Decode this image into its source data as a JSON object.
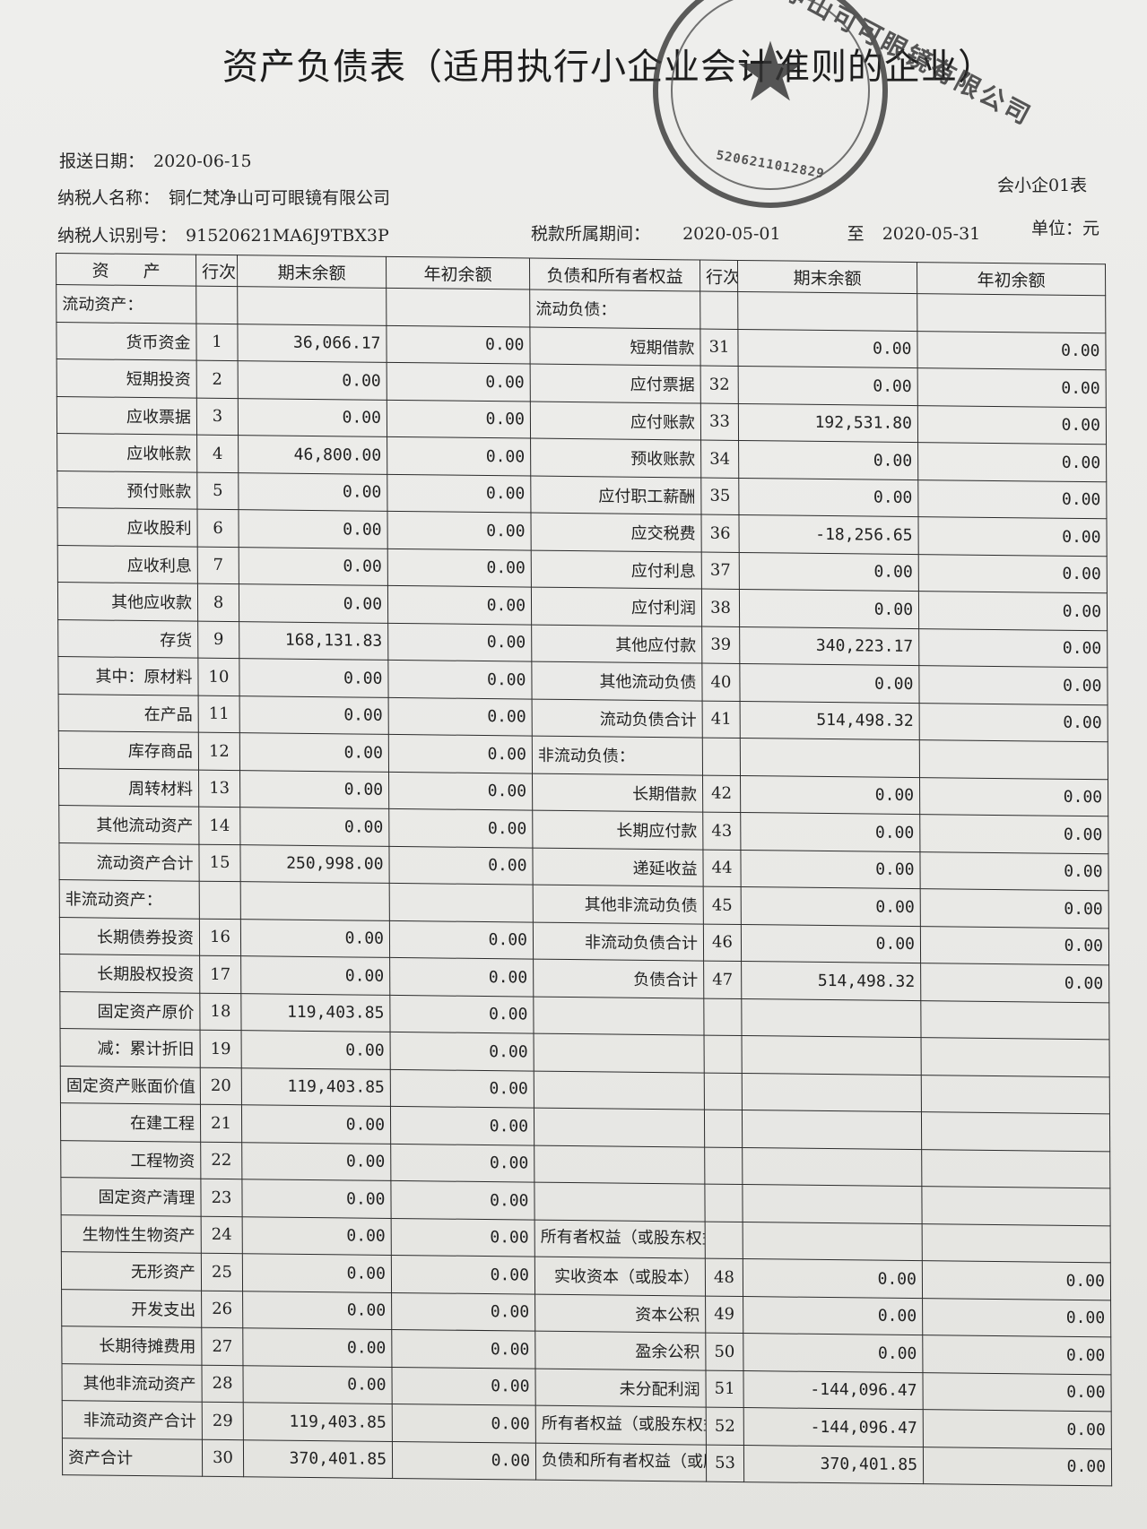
{
  "title": "资产负债表（适用执行小企业会计准则的企业）",
  "meta": {
    "report_date_label": "报送日期：",
    "report_date": "2020-06-15",
    "taxpayer_name_label": "纳税人名称：",
    "taxpayer_name": "铜仁梵净山可可眼镜有限公司",
    "taxpayer_id_label": "纳税人识别号：",
    "taxpayer_id": "91520621MA6J9TBX3P",
    "period_label": "税款所属期间：",
    "period_start": "2020-05-01",
    "period_to": "至",
    "period_end": "2020-05-31",
    "form_code": "会小企01表",
    "unit": "单位：元"
  },
  "stamp": {
    "text": "铜仁梵净山可可眼镜有限公司",
    "code": "5206211012829"
  },
  "headers": {
    "assets": "资　　产",
    "row": "行次",
    "end_balance": "期末余额",
    "begin_balance": "年初余额",
    "liabilities": "负债和所有者权益",
    "row2": "行次",
    "end_balance2": "期末余额",
    "begin_balance2": "年初余额"
  },
  "sections": {
    "current_assets": "流动资产：",
    "current_liabilities": "流动负债：",
    "noncurrent_assets": "非流动资产：",
    "noncurrent_liabilities": "非流动负债：",
    "equity": "所有者权益（或股东权益）："
  },
  "assets": [
    {
      "name": "货币资金",
      "row": "1",
      "end": "36,066.17",
      "begin": "0.00"
    },
    {
      "name": "短期投资",
      "row": "2",
      "end": "0.00",
      "begin": "0.00"
    },
    {
      "name": "应收票据",
      "row": "3",
      "end": "0.00",
      "begin": "0.00"
    },
    {
      "name": "应收帐款",
      "row": "4",
      "end": "46,800.00",
      "begin": "0.00"
    },
    {
      "name": "预付账款",
      "row": "5",
      "end": "0.00",
      "begin": "0.00"
    },
    {
      "name": "应收股利",
      "row": "6",
      "end": "0.00",
      "begin": "0.00"
    },
    {
      "name": "应收利息",
      "row": "7",
      "end": "0.00",
      "begin": "0.00"
    },
    {
      "name": "其他应收款",
      "row": "8",
      "end": "0.00",
      "begin": "0.00"
    },
    {
      "name": "存货",
      "row": "9",
      "end": "168,131.83",
      "begin": "0.00"
    },
    {
      "name": "其中：原材料",
      "row": "10",
      "end": "0.00",
      "begin": "0.00"
    },
    {
      "name": "在产品",
      "row": "11",
      "end": "0.00",
      "begin": "0.00"
    },
    {
      "name": "库存商品",
      "row": "12",
      "end": "0.00",
      "begin": "0.00"
    },
    {
      "name": "周转材料",
      "row": "13",
      "end": "0.00",
      "begin": "0.00"
    },
    {
      "name": "其他流动资产",
      "row": "14",
      "end": "0.00",
      "begin": "0.00"
    },
    {
      "name": "流动资产合计",
      "row": "15",
      "end": "250,998.00",
      "begin": "0.00"
    },
    {
      "name": "长期债券投资",
      "row": "16",
      "end": "0.00",
      "begin": "0.00"
    },
    {
      "name": "长期股权投资",
      "row": "17",
      "end": "0.00",
      "begin": "0.00"
    },
    {
      "name": "固定资产原价",
      "row": "18",
      "end": "119,403.85",
      "begin": "0.00"
    },
    {
      "name": "减：累计折旧",
      "row": "19",
      "end": "0.00",
      "begin": "0.00"
    },
    {
      "name": "固定资产账面价值",
      "row": "20",
      "end": "119,403.85",
      "begin": "0.00"
    },
    {
      "name": "在建工程",
      "row": "21",
      "end": "0.00",
      "begin": "0.00"
    },
    {
      "name": "工程物资",
      "row": "22",
      "end": "0.00",
      "begin": "0.00"
    },
    {
      "name": "固定资产清理",
      "row": "23",
      "end": "0.00",
      "begin": "0.00"
    },
    {
      "name": "生物性生物资产",
      "row": "24",
      "end": "0.00",
      "begin": "0.00"
    },
    {
      "name": "无形资产",
      "row": "25",
      "end": "0.00",
      "begin": "0.00"
    },
    {
      "name": "开发支出",
      "row": "26",
      "end": "0.00",
      "begin": "0.00"
    },
    {
      "name": "长期待摊费用",
      "row": "27",
      "end": "0.00",
      "begin": "0.00"
    },
    {
      "name": "其他非流动资产",
      "row": "28",
      "end": "0.00",
      "begin": "0.00"
    },
    {
      "name": "非流动资产合计",
      "row": "29",
      "end": "119,403.85",
      "begin": "0.00"
    },
    {
      "name": "资产合计",
      "row": "30",
      "end": "370,401.85",
      "begin": "0.00"
    }
  ],
  "liabilities": [
    {
      "name": "短期借款",
      "row": "31",
      "end": "0.00",
      "begin": "0.00"
    },
    {
      "name": "应付票据",
      "row": "32",
      "end": "0.00",
      "begin": "0.00"
    },
    {
      "name": "应付账款",
      "row": "33",
      "end": "192,531.80",
      "begin": "0.00"
    },
    {
      "name": "预收账款",
      "row": "34",
      "end": "0.00",
      "begin": "0.00"
    },
    {
      "name": "应付职工薪酬",
      "row": "35",
      "end": "0.00",
      "begin": "0.00"
    },
    {
      "name": "应交税费",
      "row": "36",
      "end": "-18,256.65",
      "begin": "0.00"
    },
    {
      "name": "应付利息",
      "row": "37",
      "end": "0.00",
      "begin": "0.00"
    },
    {
      "name": "应付利润",
      "row": "38",
      "end": "0.00",
      "begin": "0.00"
    },
    {
      "name": "其他应付款",
      "row": "39",
      "end": "340,223.17",
      "begin": "0.00"
    },
    {
      "name": "其他流动负债",
      "row": "40",
      "end": "0.00",
      "begin": "0.00"
    },
    {
      "name": "流动负债合计",
      "row": "41",
      "end": "514,498.32",
      "begin": "0.00"
    },
    {
      "name": "长期借款",
      "row": "42",
      "end": "0.00",
      "begin": "0.00"
    },
    {
      "name": "长期应付款",
      "row": "43",
      "end": "0.00",
      "begin": "0.00"
    },
    {
      "name": "递延收益",
      "row": "44",
      "end": "0.00",
      "begin": "0.00"
    },
    {
      "name": "其他非流动负债",
      "row": "45",
      "end": "0.00",
      "begin": "0.00"
    },
    {
      "name": "非流动负债合计",
      "row": "46",
      "end": "0.00",
      "begin": "0.00"
    },
    {
      "name": "负债合计",
      "row": "47",
      "end": "514,498.32",
      "begin": "0.00"
    },
    {
      "name": "实收资本（或股本）",
      "row": "48",
      "end": "0.00",
      "begin": "0.00"
    },
    {
      "name": "资本公积",
      "row": "49",
      "end": "0.00",
      "begin": "0.00"
    },
    {
      "name": "盈余公积",
      "row": "50",
      "end": "0.00",
      "begin": "0.00"
    },
    {
      "name": "未分配利润",
      "row": "51",
      "end": "-144,096.47",
      "begin": "0.00"
    },
    {
      "name": "所有者权益（或股东权益）合计",
      "row": "52",
      "end": "-144,096.47",
      "begin": "0.00"
    },
    {
      "name": "负债和所有者权益（或股东权益）总计",
      "row": "53",
      "end": "370,401.85",
      "begin": "0.00"
    }
  ]
}
